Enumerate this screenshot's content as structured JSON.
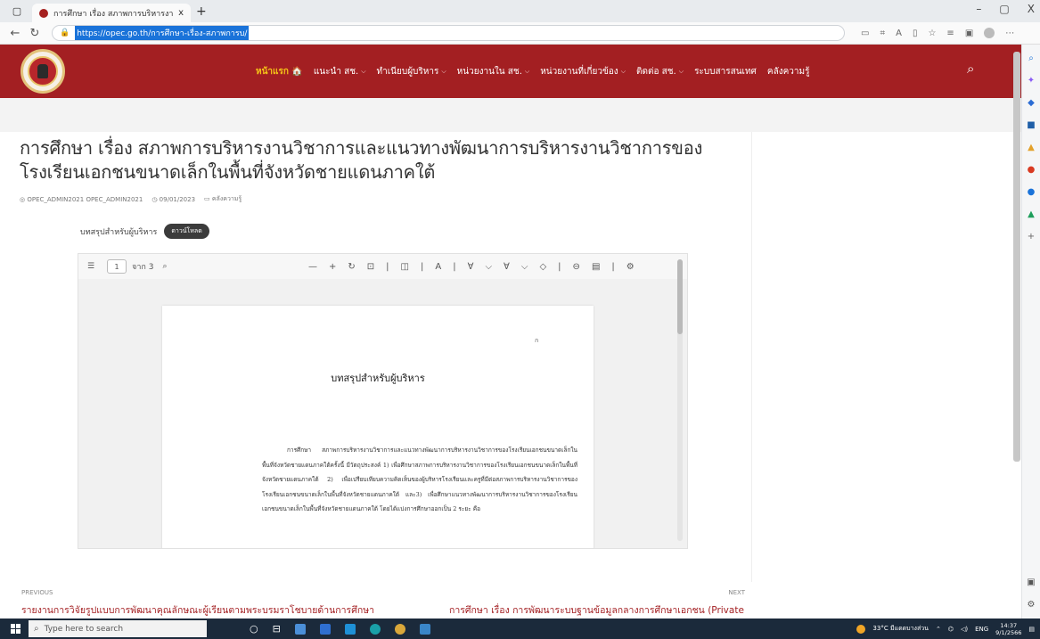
{
  "browser": {
    "tab_title": "การศึกษา เรื่อง สภาพการบริหารงานวิ",
    "tab_close": "x",
    "new_tab": "+",
    "url": "https://opec.go.th/การศึกษา-เรื่อง-สภาพการบ/",
    "window_controls": [
      "–",
      "▢",
      "X"
    ]
  },
  "site": {
    "nav": [
      {
        "label": "หน้าแรก 🏠",
        "home": true,
        "caret": ""
      },
      {
        "label": "แนะนำ สช.",
        "caret": "⌵"
      },
      {
        "label": "ทำเนียบผู้บริหาร",
        "caret": "⌵"
      },
      {
        "label": "หน่วยงานใน สช.",
        "caret": "⌵"
      },
      {
        "label": "หน่วยงานที่เกี่ยวข้อง",
        "caret": "⌵"
      },
      {
        "label": "ติดต่อ สช.",
        "caret": "⌵"
      },
      {
        "label": "ระบบสารสนเทศ",
        "caret": ""
      },
      {
        "label": "คลังความรู้",
        "caret": ""
      }
    ]
  },
  "article": {
    "title": "การศึกษา เรื่อง สภาพการบริหารงานวิชาการและแนวทางพัฒนาการบริหารงานวิชาการของ โรงเรียนเอกชนขนาดเล็กในพื้นที่จังหวัดชายแดนภาคใต้",
    "author": "OPEC_ADMIN2021 OPEC_ADMIN2021",
    "date": "09/01/2023",
    "category": "คลังความรู้",
    "pdf_label": "บทสรุปสำหรับผู้บริหาร",
    "download_label": "ดาวน์โหลด"
  },
  "pdf": {
    "page_current": "1",
    "page_total": "จาก 3",
    "page_number_mark": "ก",
    "heading": "บทสรุปสำหรับผู้บริหาร",
    "body": "การศึกษา สภาพการบริหารงานวิชาการและแนวทางพัฒนาการบริหารงานวิชาการของโรงเรียนเอกชนขนาดเล็กในพื้นที่จังหวัดชายแดนภาคใต้ครั้งนี้ มีวัตถุประสงค์ 1) เพื่อศึกษาสภาพการบริหารงานวิชาการของโรงเรียนเอกชนขนาดเล็กในพื้นที่จังหวัดชายแดนภาคใต้ 2) เพื่อเปรียบเทียบความคิดเห็นของผู้บริหารโรงเรียนและครูที่มีต่อสภาพการบริหารงานวิชาการของโรงเรียนเอกชนขนาดเล็กในพื้นที่จังหวัดชายแดนภาคใต้ และ3) เพื่อศึกษาแนวทางพัฒนาการบริหารงานวิชาการของโรงเรียนเอกชนขนาดเล็กในพื้นที่จังหวัดชายแดนภาคใต้ โดยได้แบ่งการศึกษาออกเป็น 2 ระยะ คือ"
  },
  "post_nav": {
    "prev_label": "PREVIOUS",
    "prev_title": "รายงานการวิจัยรูปแบบการพัฒนาคุณลักษณะผู้เรียนตามพระบรมราโชบายด้านการศึกษา",
    "next_label": "NEXT",
    "next_title": "การศึกษา เรื่อง การพัฒนาระบบฐานข้อมูลกลางการศึกษาเอกชน (Private"
  },
  "taskbar": {
    "search_placeholder": "Type here to search",
    "weather": "33°C มีแดดบางส่วน",
    "lang": "ENG",
    "time": "14:37",
    "date": "9/1/2566"
  },
  "colors": {
    "header_red": "#a31f22",
    "nav_home_yellow": "#f5c518",
    "url_highlight": "#1a73d9"
  }
}
